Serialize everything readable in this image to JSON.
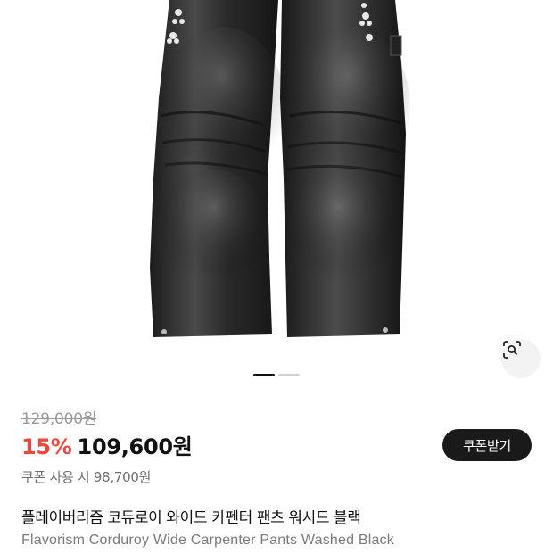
{
  "product": {
    "image_alt": "Flavorism Corduroy Wide Carpenter Pants Washed Black",
    "image_index": 1,
    "image_count": 2,
    "original_price": "129,000원",
    "discount_rate": "15%",
    "sale_price": "109,600원",
    "coupon_price_text": "쿠폰 사용 시 98,700원",
    "title_ko": "플레이버리즘 코듀로이 와이드 카펜터 팬츠 워시드 블랙",
    "title_en": "Flavorism Corduroy Wide Carpenter Pants Washed Black"
  },
  "actions": {
    "coupon_label": "쿠폰받기",
    "lens_icon": "image-search-icon"
  },
  "colors": {
    "discount": "#f0463c",
    "button_bg": "#1a1a1a",
    "pager_active": "#111111",
    "pager_inactive": "#d0d0d0"
  }
}
